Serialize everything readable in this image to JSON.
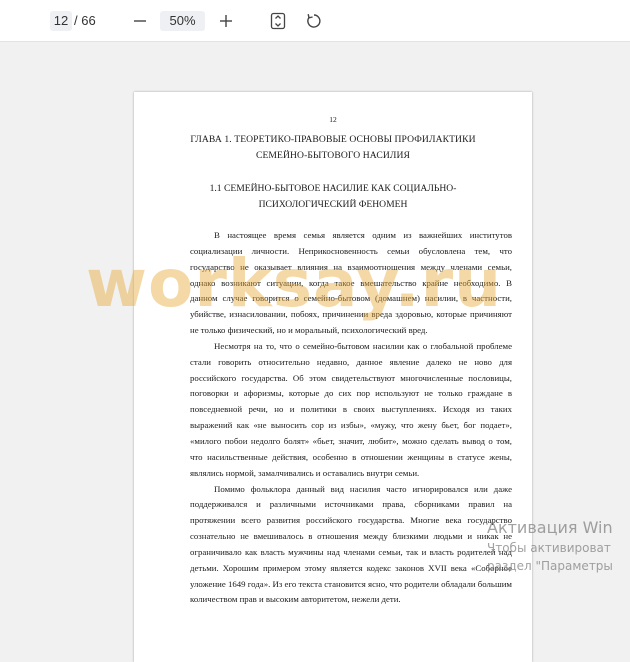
{
  "toolbar": {
    "current_page": "12",
    "total_pages": "/ 66",
    "zoom_out_label": "—",
    "zoom_level": "50%",
    "zoom_in_label": "+",
    "icons": {
      "fit": "fit-page-icon",
      "rotate": "rotate-icon"
    }
  },
  "document": {
    "page_number": "12",
    "chapter_title": "ГЛАВА 1. ТЕОРЕТИКО-ПРАВОВЫЕ ОСНОВЫ ПРОФИЛАКТИКИ СЕМЕЙНО-БЫТОВОГО НАСИЛИЯ",
    "section_title": "1.1 СЕМЕЙНО-БЫТОВОЕ НАСИЛИЕ КАК СОЦИАЛЬНО-ПСИХОЛОГИЧЕСКИЙ ФЕНОМЕН",
    "paragraphs": [
      "В настоящее время семья является одним из важнейших институтов социализации личности. Неприкосновенность семьи обусловлена тем, что государство не оказывает влияния на взаимоотношения между членами семьи, однако возникают ситуации, когда такое вмешательство крайне необходимо. В данном случае говорится о семейно-бытовом (домашнем) насилии, в частности, убийстве, изнасиловании, побоях, причинении вреда здоровью, которые причиняют не только физический, но и моральный, психологический вред.",
      "Несмотря на то, что о семейно-бытовом насилии как о глобальной проблеме стали говорить относительно недавно, данное явление далеко не ново для российского государства. Об этом свидетельствуют многочисленные пословицы, поговорки и афоризмы, которые до сих пор используют не только граждане в повседневной речи, но и политики в своих выступлениях. Исходя из таких выражений как «не выносить сор из избы», «мужу, что жену бьет, бог подает», «милого побои недолго болят» «бьет, значит, любит», можно сделать вывод о том, что насильственные действия, особенно в отношении женщины в статусе жены, являлись нормой, замалчивались и оставались внутри семьи.",
      "Помимо фольклора данный вид насилия часто игнорировался или даже поддерживался и различными источниками права, сборниками правил на протяжении всего развития российского государства. Многие века государство сознательно не вмешивалось в отношения между близкими людьми и никак не ограничивало как власть мужчины над членами семьи, так и власть родителей над детьми. Хорошим примером этому является кодекс законов XVII века «Соборное уложение 1649 года». Из его текста становится ясно, что родители обладали большим количеством прав и высоким авторитетом, нежели дети."
    ]
  },
  "overlay": {
    "watermark": "worksay.ru",
    "activation_title": "Активация Win",
    "activation_line1": "Чтобы активироват",
    "activation_line2": "раздел \"Параметры"
  },
  "colors": {
    "toolbar_bg": "#ffffff",
    "viewer_bg": "#f1f1f1",
    "watermark": "#e6aa3c"
  }
}
